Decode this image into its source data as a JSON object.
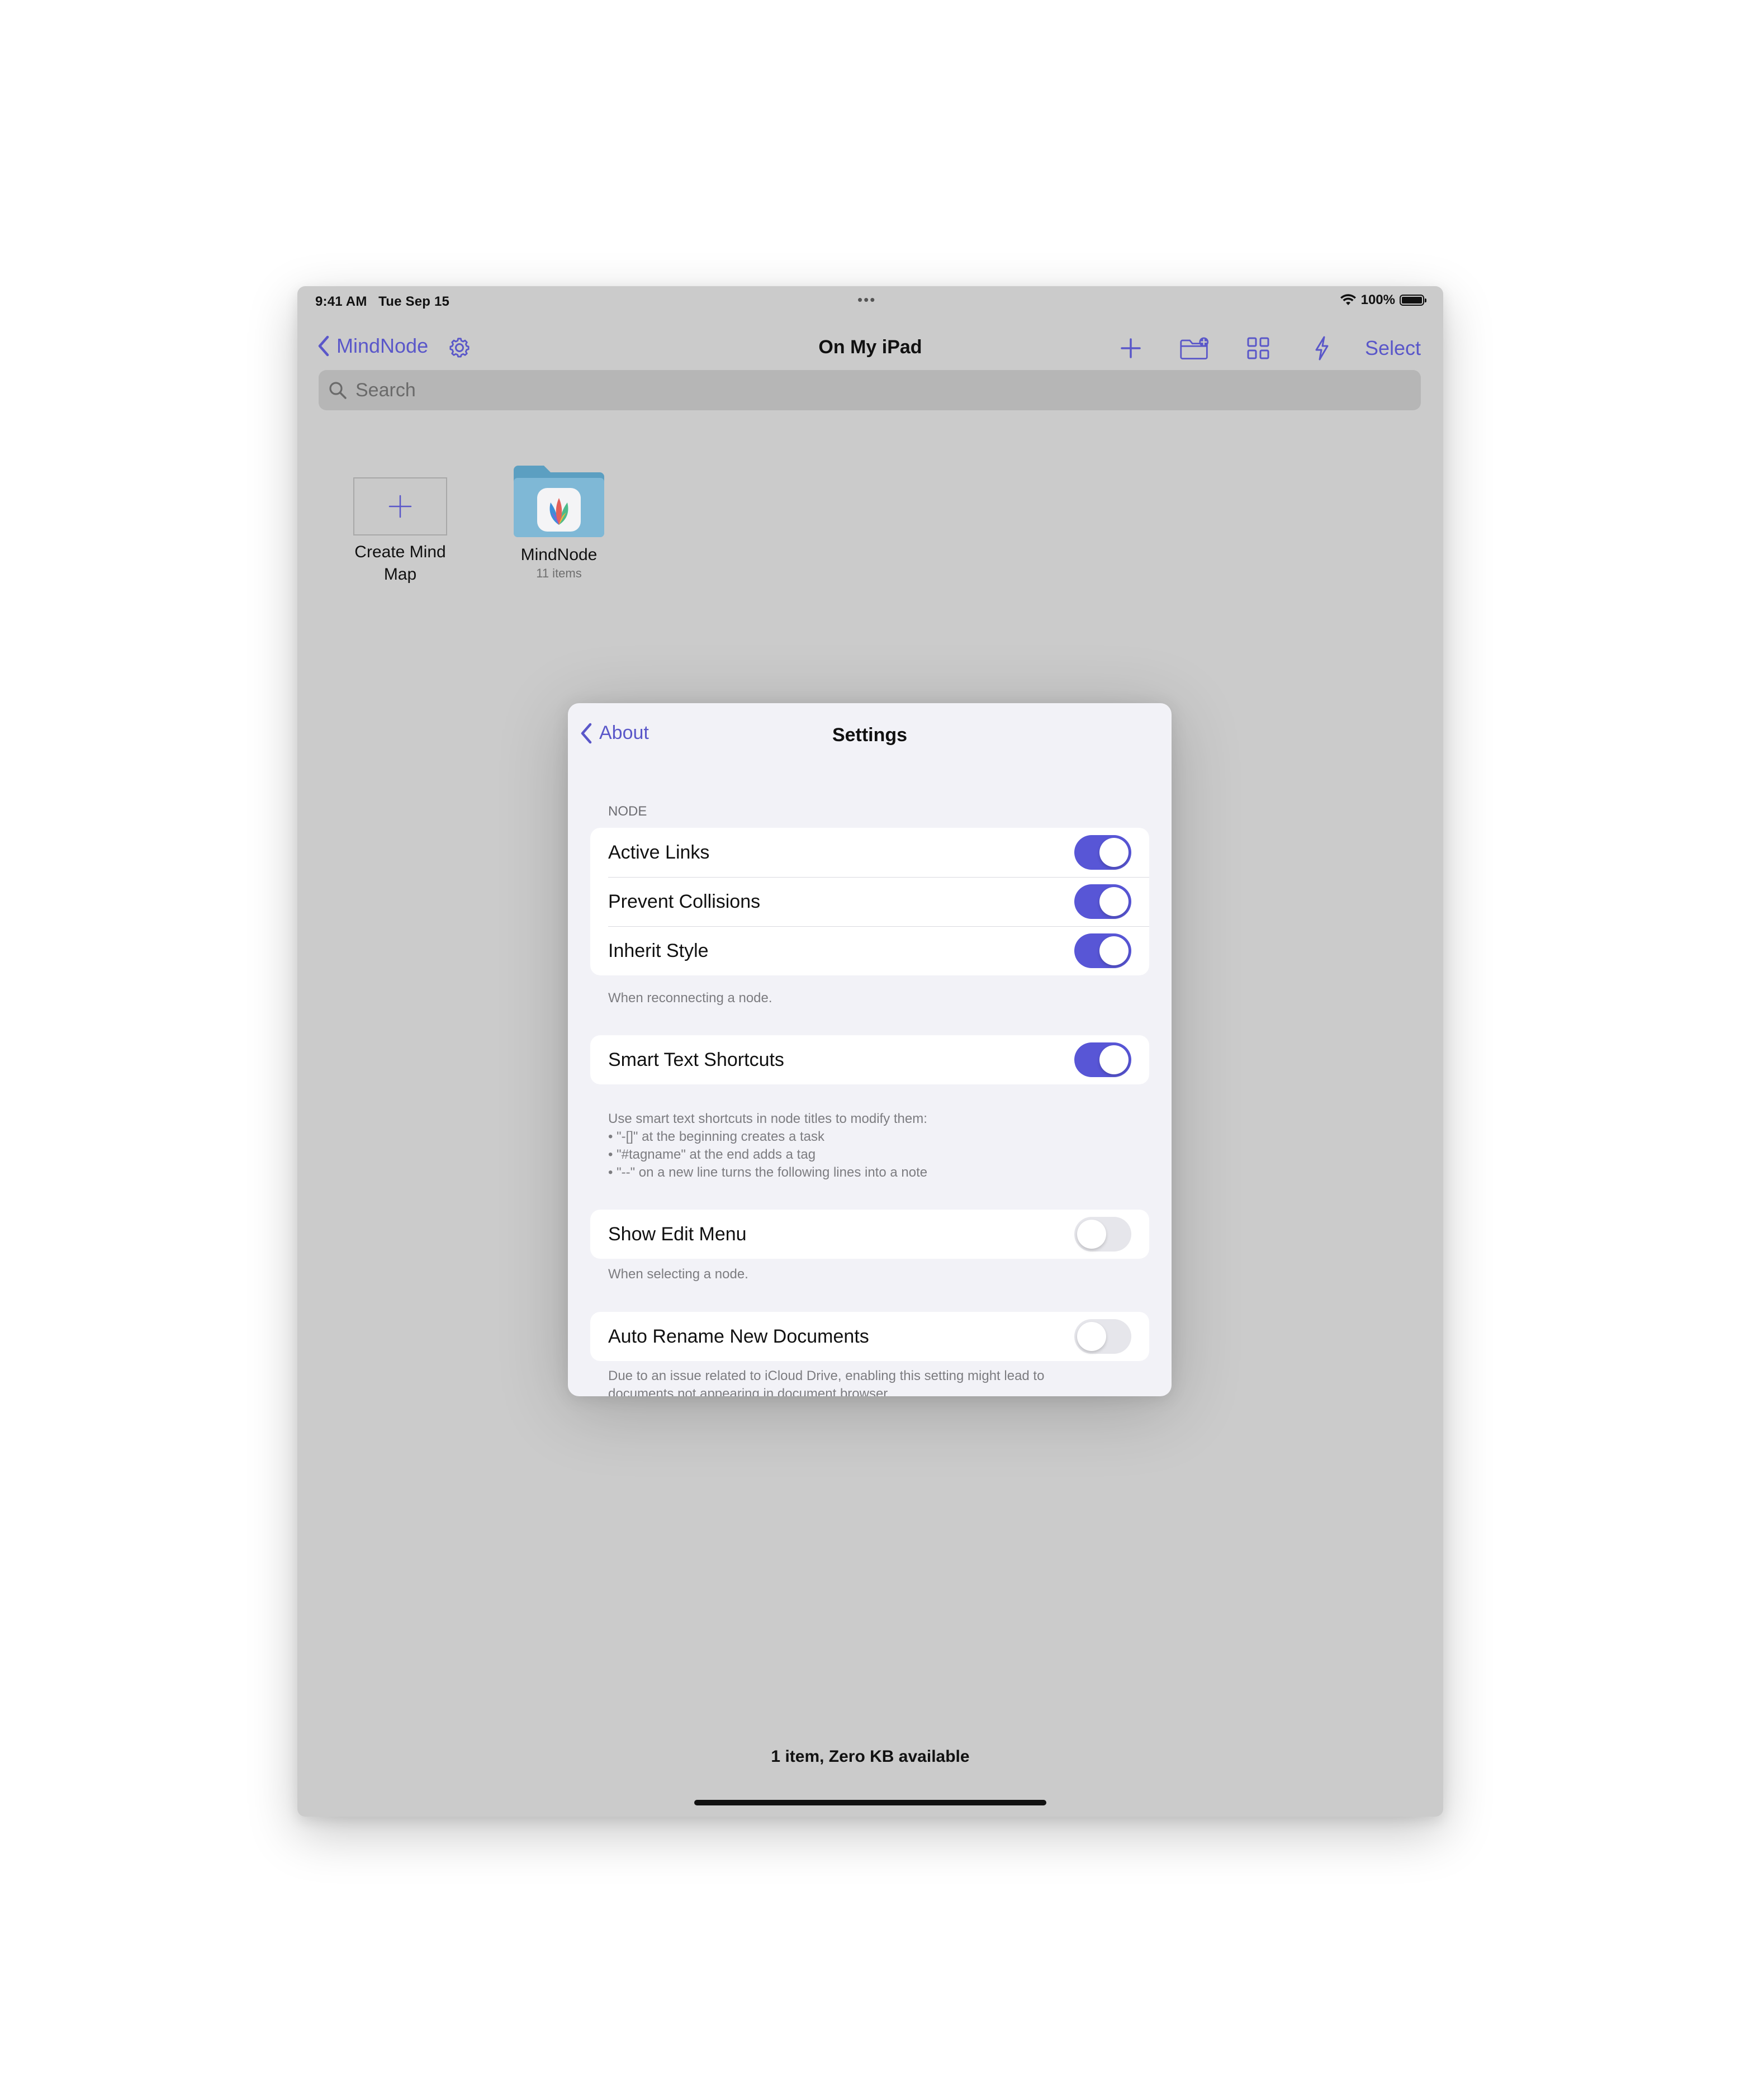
{
  "status_bar": {
    "time": "9:41 AM",
    "date": "Tue Sep 15",
    "dots": "•••",
    "battery": "100%"
  },
  "navbar": {
    "back_label": "MindNode",
    "title": "On My iPad",
    "select_label": "Select"
  },
  "search": {
    "placeholder": "Search"
  },
  "items": {
    "create_label": "Create Mind Map",
    "folder_name": "MindNode",
    "folder_count": "11 items"
  },
  "footer": {
    "summary": "1 item, Zero KB available"
  },
  "settings": {
    "back_label": "About",
    "title": "Settings",
    "node_header": "NODE",
    "rows": {
      "active_links": {
        "label": "Active Links",
        "on": true
      },
      "prevent_collisions": {
        "label": "Prevent Collisions",
        "on": true
      },
      "inherit_style": {
        "label": "Inherit Style",
        "on": true
      },
      "smart_text": {
        "label": "Smart Text Shortcuts",
        "on": true
      },
      "show_edit_menu": {
        "label": "Show Edit Menu",
        "on": false
      },
      "auto_rename": {
        "label": "Auto Rename New Documents",
        "on": false
      }
    },
    "inherit_footnote": "When reconnecting a node.",
    "smart_text_footnote": [
      "Use smart text shortcuts in node titles to modify them:",
      "• \"-[]\" at the beginning creates a task",
      "• \"#tagname\" at the end adds a tag",
      "• \"--\" on a new line turns the following lines into a note"
    ],
    "edit_menu_footnote": "When selecting a node.",
    "auto_rename_footnote": [
      "Due to an issue related to iCloud Drive, enabling this setting might lead to",
      "documents not appearing in document browser."
    ]
  },
  "colors": {
    "accent": "#5856d6",
    "background_dim": "#cbcbcb",
    "toggle_off": "#e6e6eb",
    "folder_blue": "#7fb8d6"
  },
  "icons": [
    "chevron-left-icon",
    "gear-icon",
    "plus-icon",
    "new-folder-icon",
    "grid-view-icon",
    "lightning-icon",
    "search-icon",
    "wifi-icon",
    "battery-icon",
    "folder-icon",
    "mindnode-logo-icon"
  ]
}
